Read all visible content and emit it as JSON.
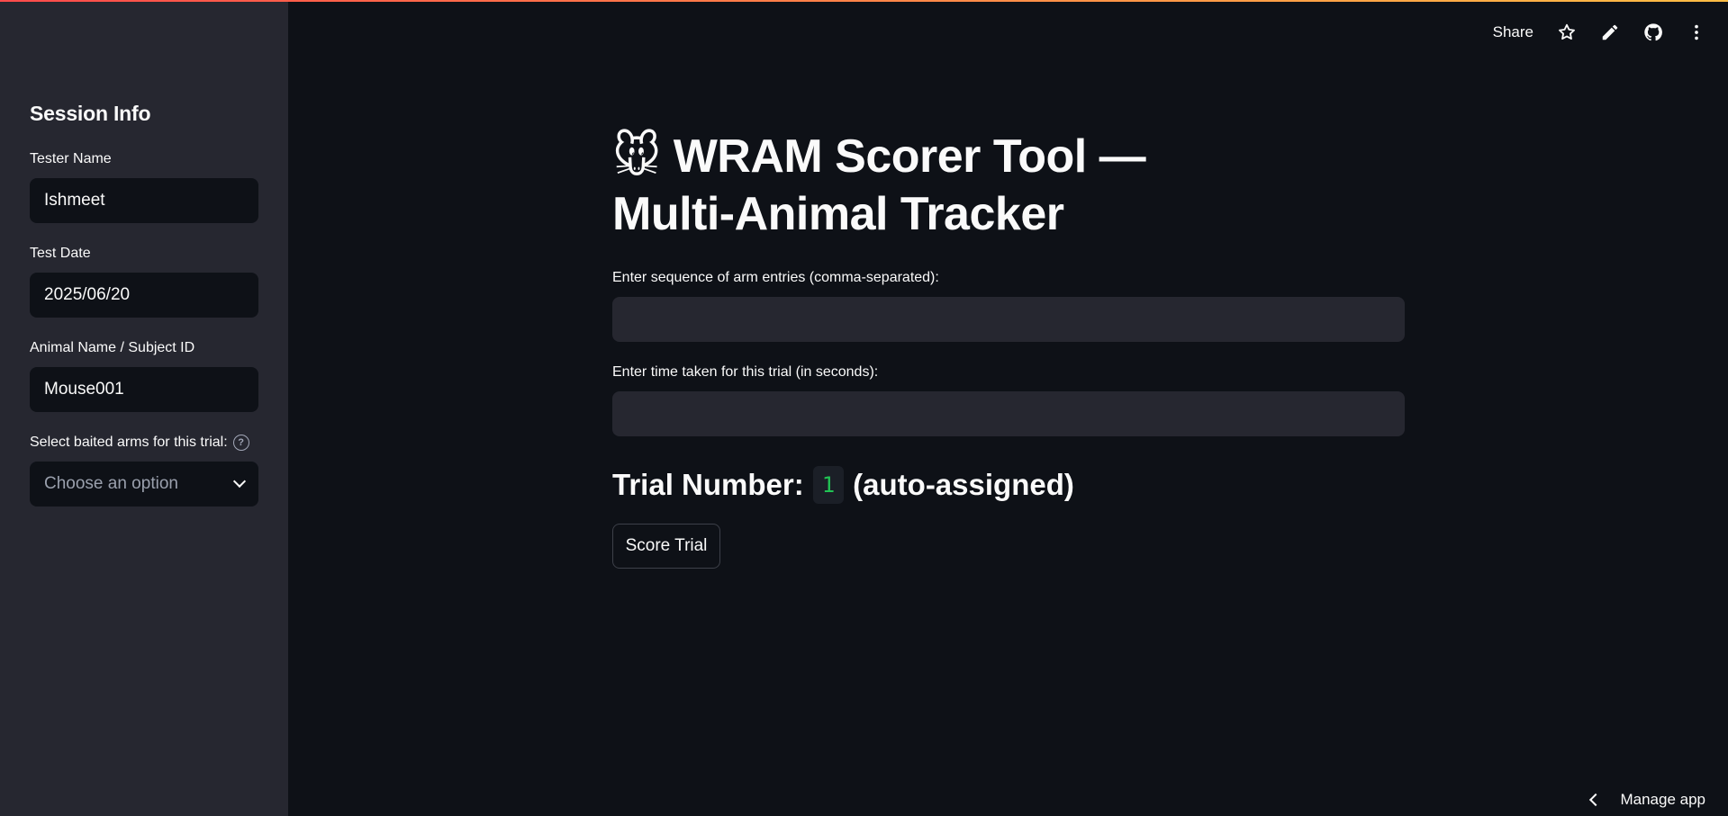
{
  "toolbar": {
    "share_label": "Share",
    "icons": [
      "star-icon",
      "pencil-icon",
      "github-icon",
      "more-vertical-icon"
    ]
  },
  "sidebar": {
    "heading": "Session Info",
    "tester": {
      "label": "Tester Name",
      "value": "Ishmeet"
    },
    "date": {
      "label": "Test Date",
      "value": "2025/06/20"
    },
    "animal": {
      "label": "Animal Name / Subject ID",
      "value": "Mouse001"
    },
    "baited": {
      "label": "Select baited arms for this trial:",
      "placeholder": "Choose an option"
    }
  },
  "main": {
    "title_emoji": "🐭",
    "title": "WRAM Scorer Tool — Multi-Animal Tracker",
    "sequence_label": "Enter sequence of arm entries (comma-separated):",
    "sequence_value": "",
    "time_label": "Enter time taken for this trial (in seconds):",
    "time_value": "",
    "trial_prefix": "Trial Number:",
    "trial_number": "1",
    "trial_suffix": "(auto-assigned)",
    "score_button": "Score Trial"
  },
  "footer": {
    "manage_label": "Manage app"
  },
  "colors": {
    "accent_green": "#21c354",
    "sidebar_bg": "#262730",
    "main_bg": "#0e1117"
  }
}
